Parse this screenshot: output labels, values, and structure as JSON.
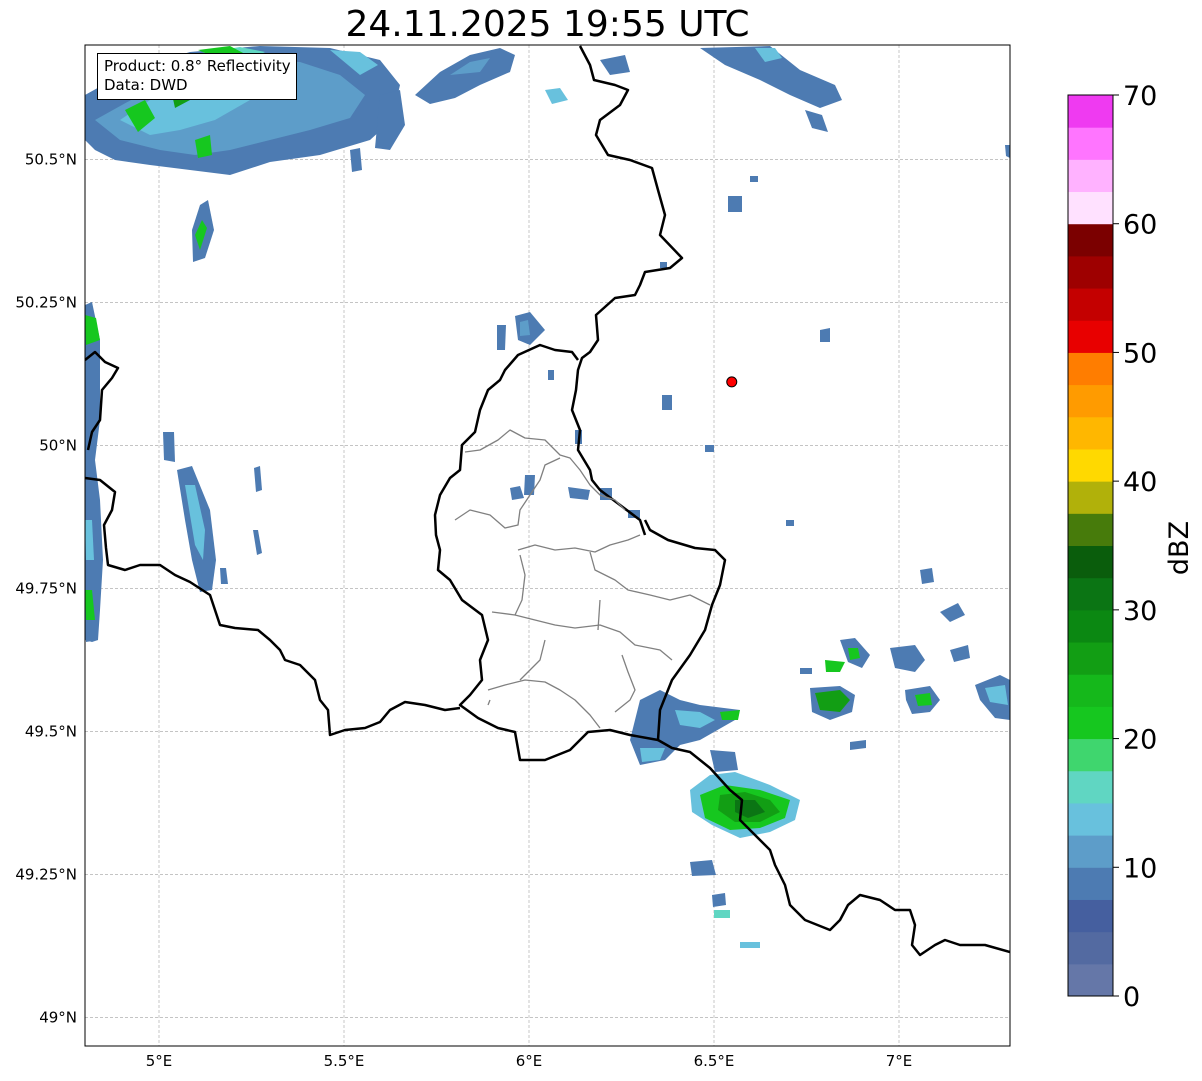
{
  "title": "24.11.2025 19:55 UTC",
  "info": {
    "product": "Product: 0.8° Reflectivity",
    "data": "Data: DWD"
  },
  "map": {
    "lon_range": [
      4.8,
      7.3
    ],
    "lat_range": [
      48.95,
      50.7
    ],
    "lon_ticks": [
      {
        "value": 5.0,
        "label": "5°E"
      },
      {
        "value": 5.5,
        "label": "5.5°E"
      },
      {
        "value": 6.0,
        "label": "6°E"
      },
      {
        "value": 6.5,
        "label": "6.5°E"
      },
      {
        "value": 7.0,
        "label": "7°E"
      }
    ],
    "lat_ticks": [
      {
        "value": 49.0,
        "label": "49°N"
      },
      {
        "value": 49.25,
        "label": "49.25°N"
      },
      {
        "value": 49.5,
        "label": "49.5°N"
      },
      {
        "value": 49.75,
        "label": "49.75°N"
      },
      {
        "value": 50.0,
        "label": "50°N"
      },
      {
        "value": 50.25,
        "label": "50.25°N"
      },
      {
        "value": 50.5,
        "label": "50.5°N"
      }
    ],
    "radar_site": {
      "lon": 6.548,
      "lat": 50.111,
      "color": "#ff0000"
    },
    "gridlines": true
  },
  "colorbar": {
    "label": "dBZ",
    "min": 0,
    "max": 70,
    "ticks": [
      {
        "value": 0,
        "label": "0"
      },
      {
        "value": 10,
        "label": "10"
      },
      {
        "value": 20,
        "label": "20"
      },
      {
        "value": 30,
        "label": "30"
      },
      {
        "value": 40,
        "label": "40"
      },
      {
        "value": 50,
        "label": "50"
      },
      {
        "value": 60,
        "label": "60"
      },
      {
        "value": 70,
        "label": "70"
      }
    ],
    "colors": [
      "#6577a8",
      "#536aa1",
      "#455f9f",
      "#4d7bb2",
      "#5d9dc9",
      "#68c1dd",
      "#60d6c2",
      "#3fd66e",
      "#16c71f",
      "#15b81b",
      "#129e14",
      "#0b8812",
      "#0b7514",
      "#0a5d0c",
      "#477b0b",
      "#b1b10a",
      "#ffd900",
      "#ffb700",
      "#ff9b00",
      "#ff7d00",
      "#e80000",
      "#c40000",
      "#9e0000",
      "#7b0000",
      "#ffe1ff",
      "#ffb2ff",
      "#ff75ff",
      "#ef3af1"
    ]
  }
}
